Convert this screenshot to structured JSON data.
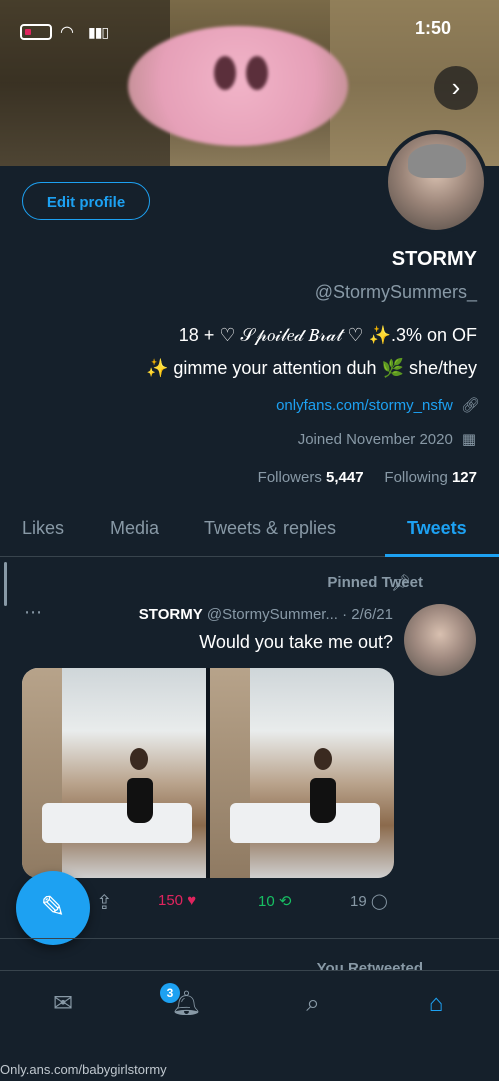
{
  "status_bar": {
    "time": "1:50"
  },
  "profile": {
    "edit_button": "Edit profile",
    "display_name": "STORMY",
    "handle": "@StormySummers_",
    "bio_line1": "18 + ♡ 𝒮𝓅𝑜𝒾𝓁𝑒𝒹 𝐵𝓇𝒶𝓉 ♡ ✨.3% on OF",
    "bio_line2": "✨ gimme your attention duh 🌿 she/they",
    "link": "onlyfans.com/stormy_nsfw",
    "joined": "Joined November 2020",
    "following_count": "127",
    "following_label": "Following",
    "followers_count": "5,447",
    "followers_label": "Followers"
  },
  "tabs": [
    "Tweets",
    "Tweets & replies",
    "Media",
    "Likes"
  ],
  "tweet": {
    "pinned_label": "Pinned Tweet",
    "author_name": "STORMY",
    "author_handle_date": "@StormySummer... · 2/6/21",
    "text": "Would you take me out?",
    "reply_count": "19",
    "retweet_count": "10",
    "like_count": "150"
  },
  "next_item_label": "You Retweeted",
  "bottom_nav": {
    "notification_badge": "3"
  },
  "watermark": "Only.ans.com/babygirlstormy",
  "colors": {
    "accent": "#1da1f2",
    "background": "#15202b",
    "retweet": "#17bf63",
    "like": "#e0245e"
  }
}
